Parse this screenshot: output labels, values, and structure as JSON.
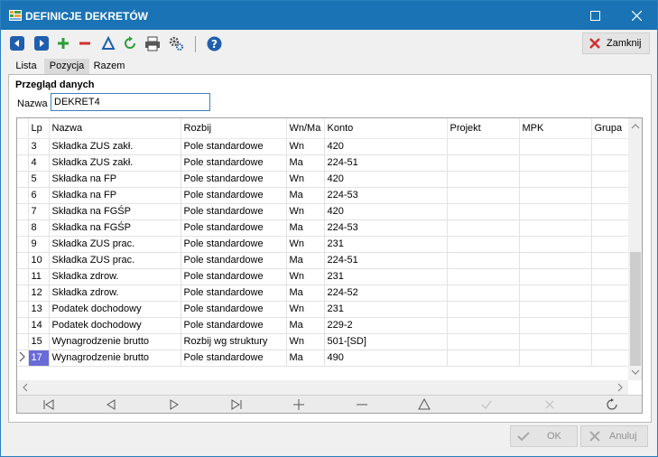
{
  "window": {
    "title": "DEFINICJE DEKRETÓW"
  },
  "toolbar": {
    "close_label": "Zamknij"
  },
  "tabs": [
    {
      "label": "Lista"
    },
    {
      "label": "Pozycja"
    },
    {
      "label": "Razem"
    }
  ],
  "panel": {
    "section_title": "Przegląd danych",
    "name_label": "Nazwa",
    "name_value": "DEKRET4"
  },
  "grid": {
    "columns": [
      "Lp",
      "Nazwa",
      "Rozbij",
      "Wn/Ma",
      "Konto",
      "Projekt",
      "MPK",
      "Grupa"
    ],
    "rows": [
      {
        "lp": "3",
        "nazwa": "Składka ZUS zakł.",
        "rozbij": "Pole standardowe",
        "wnma": "Wn",
        "konto": "420"
      },
      {
        "lp": "4",
        "nazwa": "Składka ZUS zakł.",
        "rozbij": "Pole standardowe",
        "wnma": "Ma",
        "konto": "224-51"
      },
      {
        "lp": "5",
        "nazwa": "Składka na FP",
        "rozbij": "Pole standardowe",
        "wnma": "Wn",
        "konto": "420"
      },
      {
        "lp": "6",
        "nazwa": "Składka na FP",
        "rozbij": "Pole standardowe",
        "wnma": "Ma",
        "konto": "224-53"
      },
      {
        "lp": "7",
        "nazwa": "Składka na FGŚP",
        "rozbij": "Pole standardowe",
        "wnma": "Wn",
        "konto": "420"
      },
      {
        "lp": "8",
        "nazwa": "Składka na FGŚP",
        "rozbij": "Pole standardowe",
        "wnma": "Ma",
        "konto": "224-53"
      },
      {
        "lp": "9",
        "nazwa": "Składka ZUS prac.",
        "rozbij": "Pole standardowe",
        "wnma": "Wn",
        "konto": "231"
      },
      {
        "lp": "10",
        "nazwa": "Składka ZUS prac.",
        "rozbij": "Pole standardowe",
        "wnma": "Ma",
        "konto": "224-51"
      },
      {
        "lp": "11",
        "nazwa": "Składka zdrow.",
        "rozbij": "Pole standardowe",
        "wnma": "Wn",
        "konto": "231"
      },
      {
        "lp": "12",
        "nazwa": "Składka zdrow.",
        "rozbij": "Pole standardowe",
        "wnma": "Ma",
        "konto": "224-52"
      },
      {
        "lp": "13",
        "nazwa": "Podatek dochodowy",
        "rozbij": "Pole standardowe",
        "wnma": "Wn",
        "konto": "231"
      },
      {
        "lp": "14",
        "nazwa": "Podatek dochodowy",
        "rozbij": "Pole standardowe",
        "wnma": "Ma",
        "konto": "229-2"
      },
      {
        "lp": "15",
        "nazwa": "Wynagrodzenie brutto",
        "rozbij": "Rozbij wg struktury",
        "wnma": "Wn",
        "konto": "501-[SD]"
      },
      {
        "lp": "17",
        "nazwa": "Wynagrodzenie brutto",
        "rozbij": "Pole standardowe",
        "wnma": "Ma",
        "konto": "490",
        "current": true
      }
    ]
  },
  "footer": {
    "ok_label": "OK",
    "cancel_label": "Anuluj"
  },
  "colors": {
    "titlebar": "#1a73b5",
    "current_cell": "#6a6ad8",
    "add": "#2e9e3a",
    "remove": "#d03030",
    "help": "#1f5fae"
  }
}
